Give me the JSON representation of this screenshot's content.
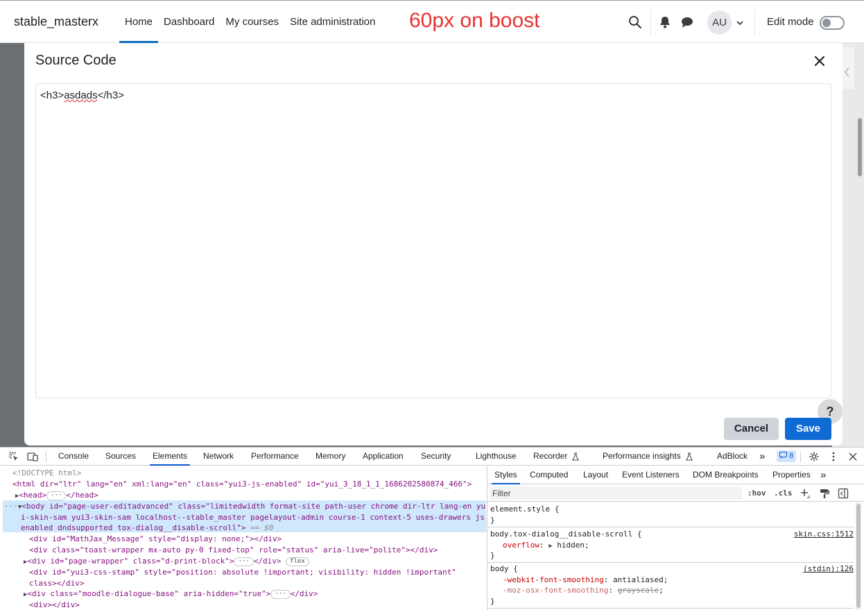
{
  "navbar": {
    "brand": "stable_masterx",
    "links": [
      {
        "label": "Home",
        "active": true
      },
      {
        "label": "Dashboard",
        "active": false
      },
      {
        "label": "My courses",
        "active": false
      },
      {
        "label": "Site administration",
        "active": false
      }
    ],
    "annotation": "60px on boost",
    "avatar_initials": "AU",
    "edit_mode_label": "Edit mode",
    "edit_mode_on": false,
    "icons": [
      "search-icon",
      "bell-icon",
      "chat-icon",
      "chevron-down-icon"
    ]
  },
  "modal": {
    "title": "Source Code",
    "code_prefix": "<h3>",
    "code_word": "asdads",
    "code_suffix": "</h3>",
    "help_label": "?",
    "cancel_label": "Cancel",
    "save_label": "Save"
  },
  "devtools": {
    "tabs": [
      "Console",
      "Sources",
      "Elements",
      "Network",
      "Performance",
      "Memory",
      "Application",
      "Security",
      "Lighthouse",
      "Recorder",
      "Performance insights",
      "AdBlock"
    ],
    "active_tab": "Elements",
    "more_tabs": "»",
    "issues_count": "8",
    "elements_lines": {
      "doctype": "<!DOCTYPE html>",
      "html_open": "<html dir=\"ltr\" lang=\"en\" xml:lang=\"en\" class=\"yui3-js-enabled\" id=\"yui_3_18_1_1_1686202580874_466\">",
      "head": "<head>",
      "head_close": "</head>",
      "body_1": "<body id=\"page-user-editadvanced\" class=\"limitedwidth format-site path-user chrome dir-ltr lang-en yu",
      "body_2": "i-skin-sam yui3-skin-sam localhost--stable_master pagelayout-admin course-1 context-5 uses-drawers js",
      "body_3": "enabled dndsupported tox-dialog__disable-scroll\">",
      "body_eq": "== $0",
      "div_mathjax": "<div id=\"MathJax_Message\" style=\"display: none;\"></div>",
      "div_toast": "<div class=\"toast-wrapper mx-auto py-0 fixed-top\" role=\"status\" aria-live=\"polite\"></div>",
      "div_page_wrapper": "<div id=\"page-wrapper\" class=\"d-print-block\">",
      "div_close": "</div>",
      "flex_pill": "flex",
      "div_stamp_1": "<div id=\"yui3-css-stamp\" style=\"position: absolute !important; visibility: hidden !important\"",
      "div_stamp_2": "class></div>",
      "div_dialogue": "<div class=\"moodle-dialogue-base\" aria-hidden=\"true\">",
      "div_empty": "<div></div>"
    },
    "styles": {
      "tabs": [
        "Styles",
        "Computed",
        "Layout",
        "Event Listeners",
        "DOM Breakpoints",
        "Properties"
      ],
      "active_tab": "Styles",
      "filter_placeholder": "Filter",
      "hov": ":hov",
      "cls": ".cls",
      "element_style": "element.style {",
      "close_brace": "}",
      "rule1_selector": "body.tox-dialog__disable-scroll {",
      "rule1_source": "skin.css:1512",
      "rule1_prop": "overflow",
      "rule1_value": "hidden;",
      "rule2_selector": "body {",
      "rule2_source": "(stdin):126",
      "rule2_prop1": "-webkit-font-smoothing",
      "rule2_value1": "antialiased;",
      "rule2_prop2": "-moz-osx-font-smoothing",
      "rule2_value2": "grayscale",
      "semicolon": ";"
    }
  }
}
